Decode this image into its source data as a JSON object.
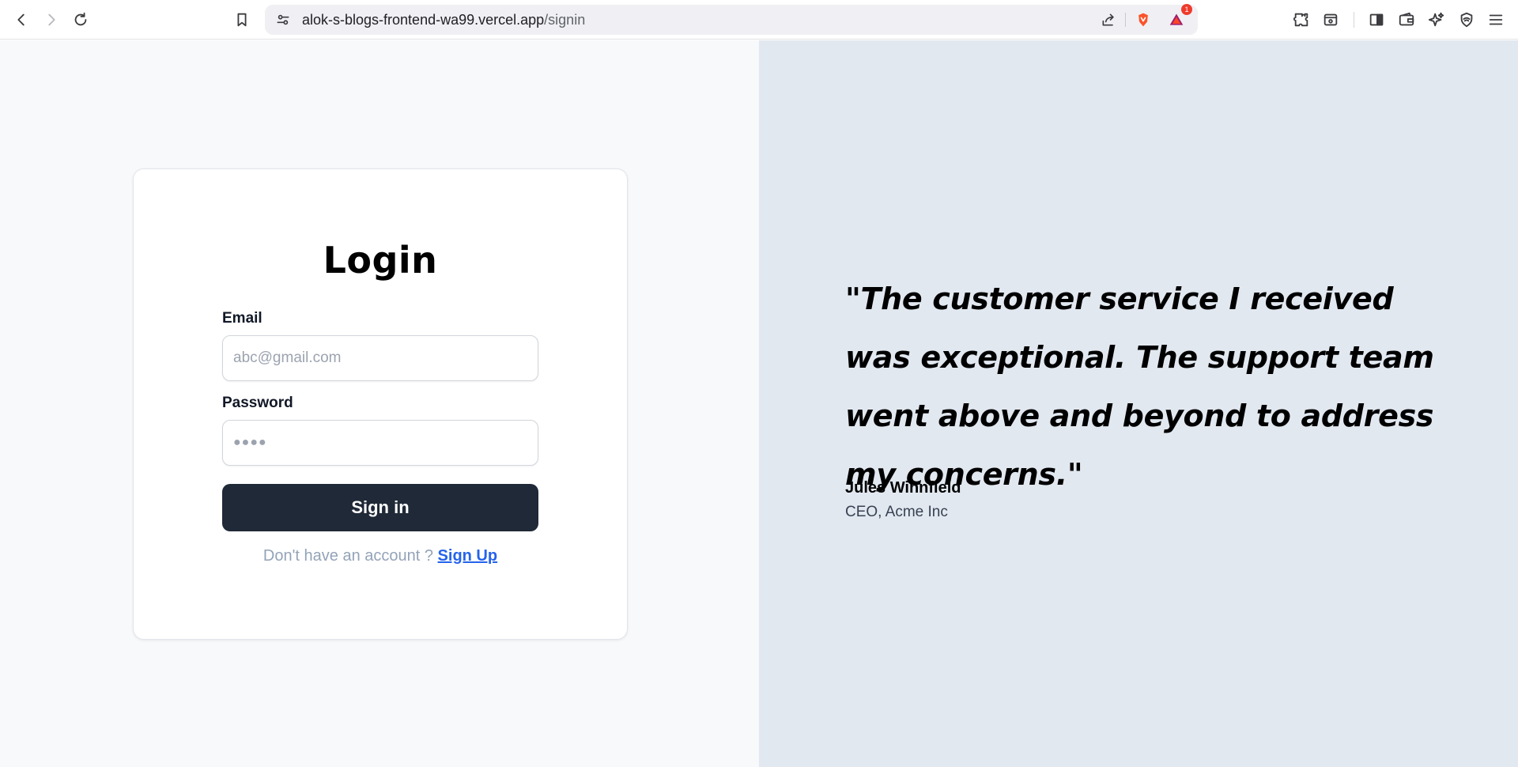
{
  "browser": {
    "url_host": "alok-s-blogs-frontend-wa99.vercel.app",
    "url_path": "/signin",
    "notification_count": "1"
  },
  "login": {
    "title": "Login",
    "email_label": "Email",
    "email_placeholder": "abc@gmail.com",
    "password_label": "Password",
    "password_dots": "●●●●",
    "signin_label": "Sign in",
    "no_account_text": "Don't have an account ? ",
    "signup_label": "Sign Up"
  },
  "testimonial": {
    "quote": "\"The customer service I received was exceptional. The support team went above and beyond to address my concerns.\"",
    "author": "Jules Winnfield",
    "role": "CEO, Acme Inc"
  },
  "colors": {
    "left_bg": "#f8f9fb",
    "right_bg": "#e2e8f0",
    "button_bg": "#1f2937",
    "link": "#2563eb"
  }
}
